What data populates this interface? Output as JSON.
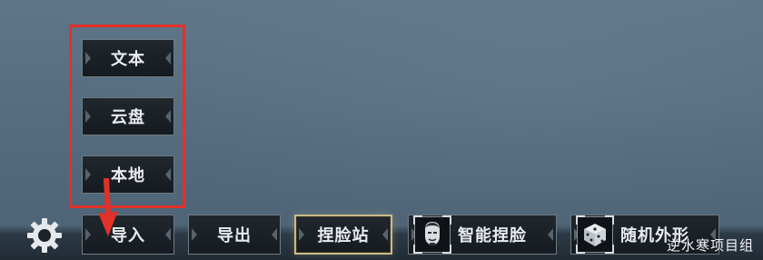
{
  "menu": {
    "items": [
      {
        "label": "文本"
      },
      {
        "label": "云盘"
      },
      {
        "label": "本地"
      }
    ]
  },
  "toolbar": {
    "import_label": "导入",
    "export_label": "导出",
    "face_station_label": "捏脸站",
    "smart_face_label": "智能捏脸",
    "random_look_label": "随机外形"
  },
  "icons": {
    "settings": "gear-icon",
    "smart_face": "face-portrait-icon",
    "random_look": "dice-icon",
    "annotation_arrow": "red-arrow-icon"
  },
  "colors": {
    "highlight_box": "#e2312a",
    "selected_border": "#c9b98a"
  },
  "watermark": "逆水寒项目组"
}
